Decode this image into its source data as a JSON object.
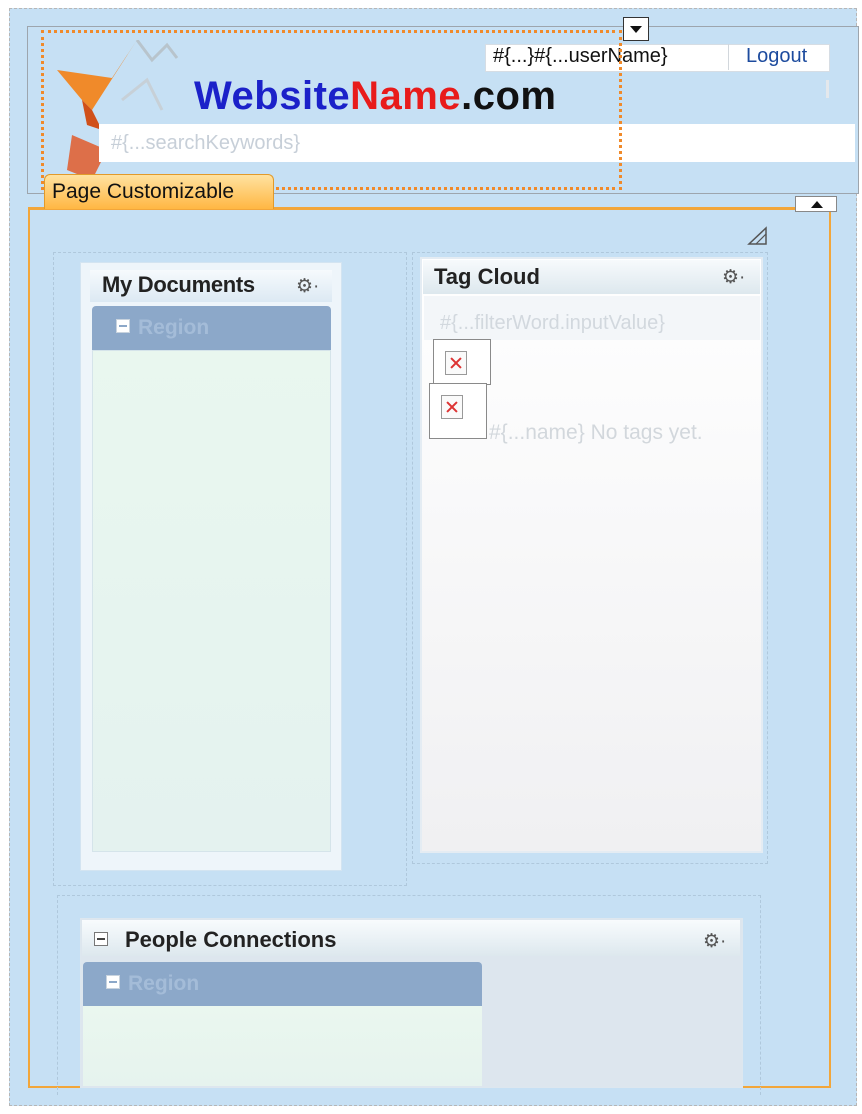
{
  "header": {
    "brand": {
      "part1": "Website",
      "part2": "Name",
      "part3": ".com"
    },
    "user_name": "#{...}#{...userName}",
    "logout_label": "Logout",
    "search_placeholder": "#{...searchKeywords}"
  },
  "page_customizable": {
    "tab_label": "Page Customizable"
  },
  "panels": {
    "my_documents": {
      "title": "My Documents",
      "region_label": "Region"
    },
    "tag_cloud": {
      "title": "Tag Cloud",
      "filter_placeholder": "#{...filterWord.inputValue}",
      "empty_text": "#{...name} No tags yet."
    },
    "people_connections": {
      "title": "People Connections",
      "region_label": "Region"
    }
  },
  "icons": {
    "gear": "gear-icon",
    "collapse": "minus-square-icon",
    "broken_image": "broken-image-icon",
    "menu": "chevron-down-icon",
    "toggle": "chevron-up-icon",
    "resize": "resize-corner-icon"
  },
  "colors": {
    "page_background": "#c6e0f4",
    "brand_blue": "#1b21c9",
    "brand_red": "#e81b1b",
    "selection_orange": "#f08a2a",
    "tab_orange": "#ffb743",
    "region_bar": "#8ca8c9"
  }
}
